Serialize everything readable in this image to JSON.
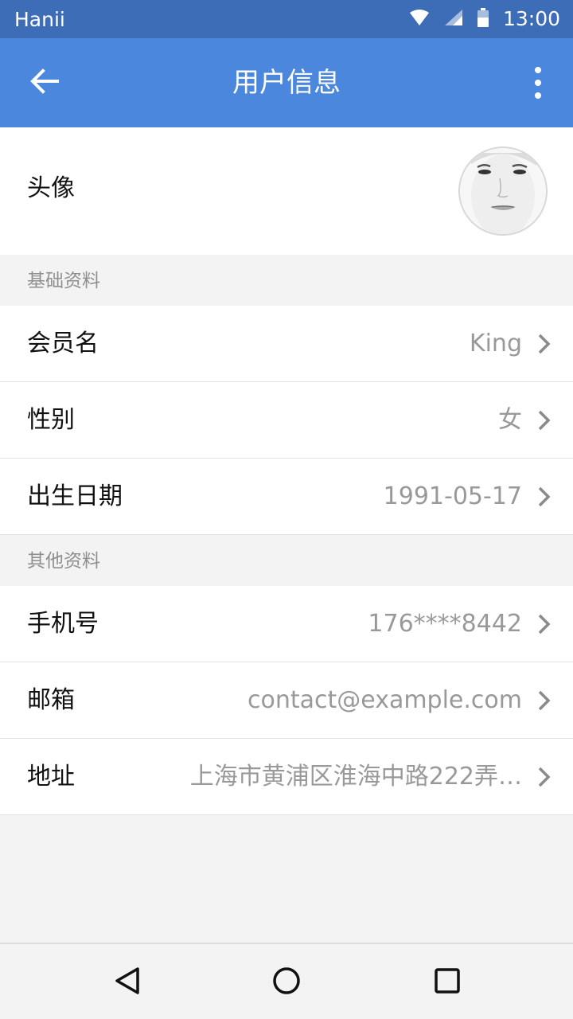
{
  "status_bar": {
    "carrier": "Hanii",
    "time": "13:00",
    "icons": [
      "wifi-icon",
      "signal-icon",
      "battery-icon"
    ]
  },
  "app_bar": {
    "title": "用户信息",
    "back_icon": "arrow-left-icon",
    "menu_icon": "more-vertical-icon"
  },
  "avatar_row": {
    "label": "头像"
  },
  "sections": [
    {
      "header": "基础资料",
      "rows": [
        {
          "label": "会员名",
          "value": "King"
        },
        {
          "label": "性别",
          "value": "女"
        },
        {
          "label": "出生日期",
          "value": "1991-05-17"
        }
      ]
    },
    {
      "header": "其他资料",
      "rows": [
        {
          "label": "手机号",
          "value": "176****8442"
        },
        {
          "label": "邮箱",
          "value": "contact@example.com"
        },
        {
          "label": "地址",
          "value": "上海市黄浦区淮海中路222弄…"
        }
      ]
    }
  ],
  "nav_bar": {
    "icons": [
      "back-triangle-icon",
      "home-circle-icon",
      "recents-square-icon"
    ]
  },
  "colors": {
    "status_bar": "#3c6db6",
    "app_bar": "#4a87dd",
    "background": "#f3f3f3",
    "value_text": "#999999"
  }
}
